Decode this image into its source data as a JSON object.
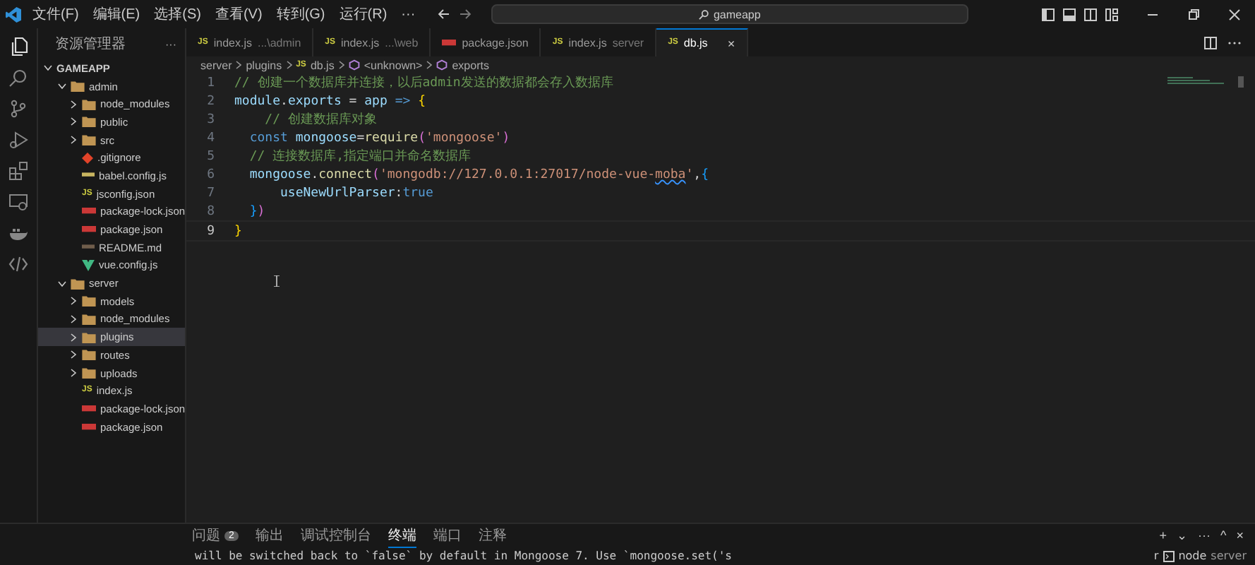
{
  "title_bar": {
    "menus": [
      "文件(F)",
      "编辑(E)",
      "选择(S)",
      "查看(V)",
      "转到(G)",
      "运行(R)",
      "···"
    ],
    "search": {
      "value": "gameapp"
    }
  },
  "sidebar": {
    "title": "资源管理器",
    "more": "···",
    "root": {
      "label": "GAMEAPP",
      "expanded": true
    },
    "items": [
      {
        "label": "admin",
        "kind": "folder",
        "expanded": true,
        "selected": false,
        "children": [
          {
            "label": "node_modules",
            "kind": "folder",
            "expanded": false,
            "selected": false
          },
          {
            "label": "public",
            "kind": "folder",
            "expanded": false,
            "selected": false
          },
          {
            "label": "src",
            "kind": "folder",
            "expanded": false,
            "selected": false
          },
          {
            "label": ".gitignore",
            "kind": "git",
            "selected": false
          },
          {
            "label": "babel.config.js",
            "kind": "babel",
            "selected": false
          },
          {
            "label": "jsconfig.json",
            "kind": "js",
            "icon": "JS",
            "selected": false
          },
          {
            "label": "package-lock.json",
            "kind": "npm",
            "selected": false
          },
          {
            "label": "package.json",
            "kind": "npm",
            "selected": false
          },
          {
            "label": "README.md",
            "kind": "md",
            "selected": false
          },
          {
            "label": "vue.config.js",
            "kind": "vue",
            "selected": false
          }
        ]
      },
      {
        "label": "server",
        "kind": "folder",
        "expanded": true,
        "selected": false,
        "children": [
          {
            "label": "models",
            "kind": "folder",
            "expanded": false,
            "selected": false
          },
          {
            "label": "node_modules",
            "kind": "folder",
            "expanded": false,
            "selected": false
          },
          {
            "label": "plugins",
            "kind": "folder",
            "expanded": false,
            "selected": true
          },
          {
            "label": "routes",
            "kind": "folder",
            "expanded": false,
            "selected": false
          },
          {
            "label": "uploads",
            "kind": "folder",
            "expanded": false,
            "selected": false
          },
          {
            "label": "index.js",
            "kind": "js",
            "icon": "JS",
            "selected": false
          },
          {
            "label": "package-lock.json",
            "kind": "npm",
            "selected": false
          },
          {
            "label": "package.json",
            "kind": "npm",
            "selected": false
          }
        ]
      }
    ]
  },
  "tabs": [
    {
      "kind": "js",
      "icon": "JS",
      "name": "index.js",
      "description": "...\\admin",
      "selected": false
    },
    {
      "kind": "js",
      "icon": "JS",
      "name": "index.js",
      "description": "...\\web",
      "selected": false
    },
    {
      "kind": "npm",
      "name": "package.json",
      "selected": false
    },
    {
      "kind": "js",
      "icon": "JS",
      "name": "index.js",
      "description": "server",
      "selected": false
    },
    {
      "kind": "js",
      "icon": "JS",
      "name": "db.js",
      "selected": true,
      "close": "×"
    }
  ],
  "breadcrumb": [
    {
      "kind": "folder",
      "label": "server"
    },
    {
      "kind": "folder",
      "label": "plugins"
    },
    {
      "kind": "js",
      "icon": "JS",
      "label": "db.js"
    },
    {
      "kind": "symbol",
      "label": "<unknown>"
    },
    {
      "kind": "symbol",
      "label": "exports"
    }
  ],
  "code": [
    {
      "number": "1",
      "tokens": [
        {
          "kind": "comment",
          "text": "// 创建一个数据库并连接，以后admin发送的数据都会存入数据库"
        }
      ]
    },
    {
      "number": "2",
      "tokens": [
        {
          "kind": "variable",
          "text": "module"
        },
        {
          "kind": "plain",
          "text": "."
        },
        {
          "kind": "variable",
          "text": "exports"
        },
        {
          "kind": "plain",
          "text": " = "
        },
        {
          "kind": "variable",
          "text": "app"
        },
        {
          "kind": "keyword",
          "text": " => "
        },
        {
          "kind": "bracket",
          "text": "{"
        }
      ]
    },
    {
      "number": "3",
      "tokens": [
        {
          "kind": "comment",
          "text": "    // 创建数据库对象"
        }
      ]
    },
    {
      "number": "4",
      "tokens": [
        {
          "kind": "keyword",
          "text": "  const "
        },
        {
          "kind": "variable",
          "text": "mongoose"
        },
        {
          "kind": "plain",
          "text": "="
        },
        {
          "kind": "function",
          "text": "require"
        },
        {
          "kind": "bracket2",
          "text": "("
        },
        {
          "kind": "string",
          "text": "'mongoose'"
        },
        {
          "kind": "bracket2",
          "text": ")"
        }
      ]
    },
    {
      "number": "5",
      "tokens": [
        {
          "kind": "comment",
          "text": "  // 连接数据库,指定端口并命名数据库"
        }
      ]
    },
    {
      "number": "6",
      "tokens": [
        {
          "kind": "variable",
          "text": "  mongoose"
        },
        {
          "kind": "plain",
          "text": "."
        },
        {
          "kind": "function",
          "text": "connect"
        },
        {
          "kind": "bracket2",
          "text": "("
        },
        {
          "kind": "string",
          "text": "'mongodb://127.0.0.1:27017/node-vue-"
        },
        {
          "kind": "misspelled",
          "text": "moba"
        },
        {
          "kind": "string",
          "text": "'"
        },
        {
          "kind": "plain",
          "text": ","
        },
        {
          "kind": "bracket3",
          "text": "{"
        }
      ]
    },
    {
      "number": "7",
      "tokens": [
        {
          "kind": "variable",
          "text": "      useNewUrlParser"
        },
        {
          "kind": "plain",
          "text": ":"
        },
        {
          "kind": "keyword",
          "text": "true"
        }
      ]
    },
    {
      "number": "8",
      "tokens": [
        {
          "kind": "bracket3",
          "text": "  }"
        },
        {
          "kind": "bracket2",
          "text": ")"
        }
      ]
    },
    {
      "number": "9",
      "tokens": [
        {
          "kind": "bracket",
          "text": "}"
        }
      ]
    }
  ],
  "panel": {
    "tabs": [
      {
        "label": "问题",
        "badge": "2",
        "selected": false
      },
      {
        "label": "输出",
        "selected": false
      },
      {
        "label": "调试控制台",
        "selected": false
      },
      {
        "label": "终端",
        "selected": true
      },
      {
        "label": "端口",
        "selected": false
      },
      {
        "label": "注释",
        "selected": false
      }
    ],
    "actions": [
      "+",
      "⌄",
      "···",
      "^",
      "×"
    ],
    "terminal_text": "will be switched back to `false` by default in Mongoose 7. Use `mongoose.set('s",
    "terminal_list": {
      "cut_text": "r",
      "name": "node",
      "description": "server"
    }
  }
}
